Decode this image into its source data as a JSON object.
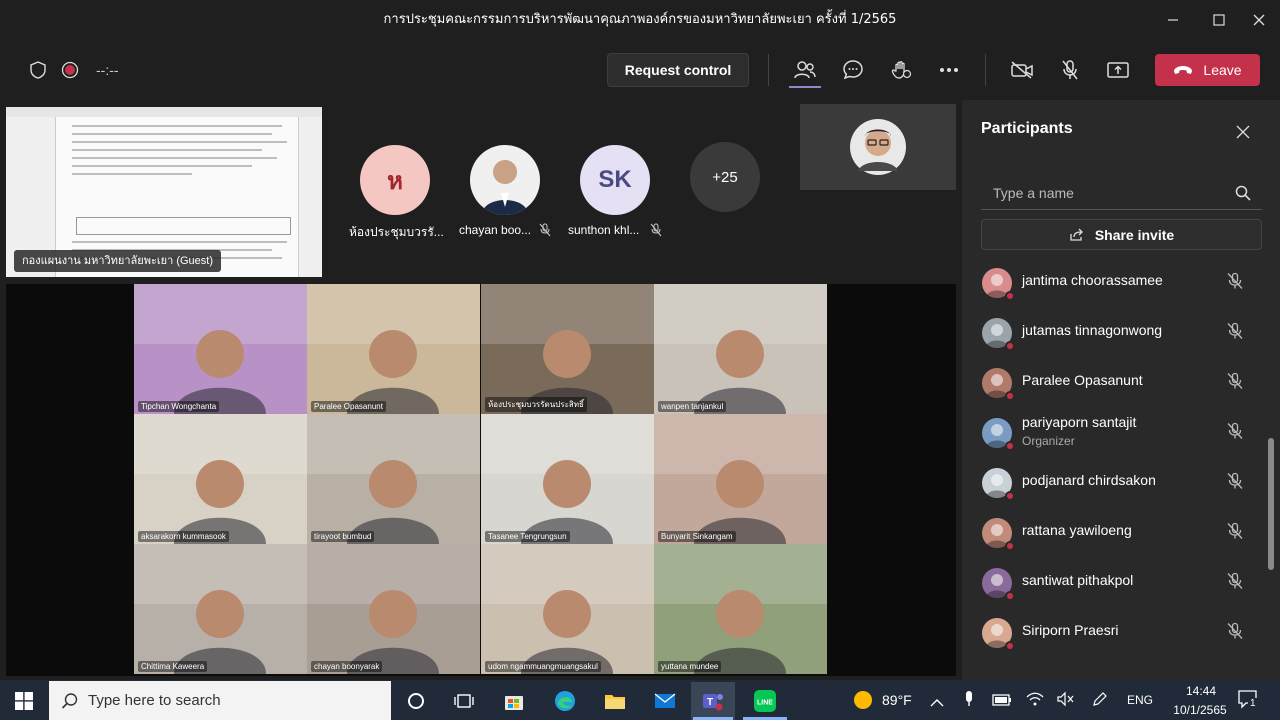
{
  "window": {
    "title": "การประชุมคณะกรรมการบริหารพัฒนาคุณภาพองค์กรของมหาวิทยาลัยพะเยา ครั้งที่ 1/2565"
  },
  "toolbar": {
    "timer": "--:--",
    "request_control": "Request control",
    "leave": "Leave"
  },
  "stage": {
    "screen_sharer": "กองแผนงาน มหาวิทยาลัยพะเยา (Guest)",
    "avatars": [
      {
        "initials": "ห",
        "label": "ห้องประชุมบวรรั...",
        "bg": "#f4c7c3",
        "fg": "#a4262c"
      },
      {
        "initials": "",
        "label": "chayan boo...",
        "bg": "#ffffff",
        "fg": "#000000"
      },
      {
        "initials": "SK",
        "label": "sunthon khl...",
        "bg": "#e5e0f4",
        "fg": "#4b4a83"
      },
      {
        "initials": "+25",
        "label": "",
        "bg": "#3a3a3a",
        "fg": "#ffffff"
      }
    ],
    "tiles": [
      {
        "name": "Tipchan Wongchanta",
        "bg": "#b892c6"
      },
      {
        "name": "Paralee Opasanunt",
        "bg": "#cbb89a"
      },
      {
        "name": "ห้องประชุมบวรรัตนประสิทธิ์",
        "bg": "#7a6a5a"
      },
      {
        "name": "wanpen tanjankul",
        "bg": "#c9c2b8"
      },
      {
        "name": "aksarakorn kummasook",
        "bg": "#d8d2c6"
      },
      {
        "name": "tirayoot bumbud",
        "bg": "#b8b0a4"
      },
      {
        "name": "Tasanee Tengrungsun",
        "bg": "#d8d6d0"
      },
      {
        "name": "Bunyarit Sinkangam",
        "bg": "#c2a89a"
      },
      {
        "name": "Chittima Kaweera",
        "bg": "#b7b0a8"
      },
      {
        "name": "chayan boonyarak",
        "bg": "#a89e94"
      },
      {
        "name": "udom ngammuangmuangsakul",
        "bg": "#cbbfb0"
      },
      {
        "name": "yuttana mundee",
        "bg": "#8fa07a"
      }
    ]
  },
  "panel": {
    "title": "Participants",
    "search_placeholder": "Type a name",
    "share_invite": "Share invite",
    "participants": [
      {
        "name": "jantima choorassamee",
        "role": "",
        "color": "#d98c8c"
      },
      {
        "name": "jutamas tinnagonwong",
        "role": "",
        "color": "#9aa4aa"
      },
      {
        "name": "Paralee Opasanunt",
        "role": "",
        "color": "#b07a6a"
      },
      {
        "name": "pariyaporn santajit",
        "role": "Organizer",
        "color": "#7a9cc2"
      },
      {
        "name": "podjanard chirdsakon",
        "role": "",
        "color": "#c9d0d6"
      },
      {
        "name": "rattana yawiloeng",
        "role": "",
        "color": "#c28a7a"
      },
      {
        "name": "santiwat pithakpol",
        "role": "",
        "color": "#8a6a9a"
      },
      {
        "name": "Siriporn Praesri",
        "role": "",
        "color": "#d8a890"
      }
    ]
  },
  "taskbar": {
    "search_placeholder": "Type here to search",
    "weather": "89°F",
    "language": "ENG",
    "time": "14:44",
    "date": "10/1/2565",
    "notifications": "1"
  }
}
